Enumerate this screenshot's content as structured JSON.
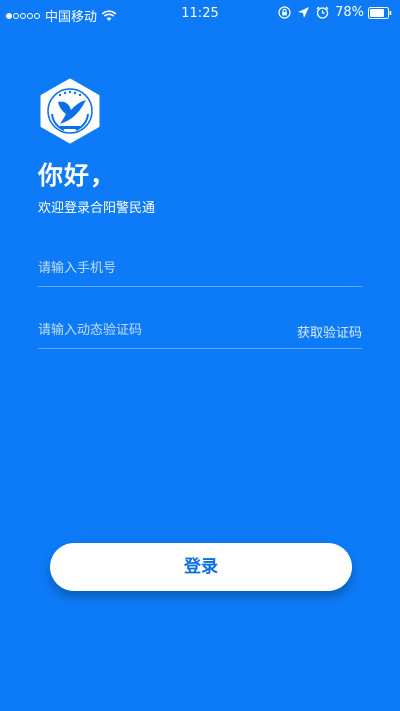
{
  "status_bar": {
    "carrier": "中国移动",
    "time": "11:25",
    "battery": "78%",
    "signal_icon": "signal-dots-icon",
    "wifi_icon": "wifi-icon",
    "lock_icon": "rotation-lock-icon",
    "location_icon": "location-arrow-icon",
    "alarm_icon": "alarm-clock-icon",
    "battery_icon": "battery-icon"
  },
  "header": {
    "logo_icon": "police-badge-dove-logo",
    "greeting": "你好，",
    "welcome": "欢迎登录合阳警民通"
  },
  "form": {
    "phone_placeholder": "请输入手机号",
    "phone_value": "",
    "code_placeholder": "请输入动态验证码",
    "code_value": "",
    "get_code_label": "获取验证码",
    "login_label": "登录"
  },
  "colors": {
    "background": "#0d7bf7",
    "button_text": "#0d6fe5",
    "button_bg": "#ffffff"
  }
}
